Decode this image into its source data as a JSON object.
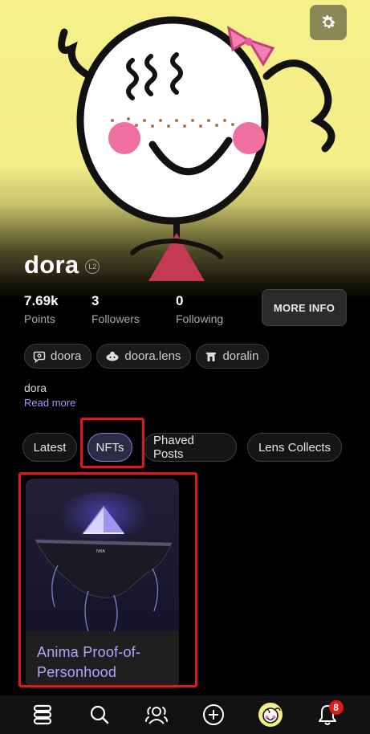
{
  "profile": {
    "name": "dora",
    "level_badge": "L2",
    "bio": "dora",
    "read_more_label": "Read more"
  },
  "stats": [
    {
      "value": "7.69k",
      "label": "Points"
    },
    {
      "value": "3",
      "label": "Followers"
    },
    {
      "value": "0",
      "label": "Following"
    }
  ],
  "more_info_label": "MORE INFO",
  "handles": [
    {
      "icon": "chat-bubble-icon",
      "label": "doora"
    },
    {
      "icon": "lens-leaf-icon",
      "label": "doora.lens"
    },
    {
      "icon": "gate-icon",
      "label": "doralin"
    }
  ],
  "tabs": [
    {
      "label": "Latest",
      "active": false
    },
    {
      "label": "NFTs",
      "active": true
    },
    {
      "label": "Phaved Posts",
      "active": false
    },
    {
      "label": "Lens Collects",
      "active": false
    }
  ],
  "nfts": [
    {
      "title": "Anima Proof-of-Personhood",
      "image": "floating-island-pyramid"
    }
  ],
  "bottom_nav": [
    {
      "icon": "feed-stack-icon"
    },
    {
      "icon": "search-icon"
    },
    {
      "icon": "people-icon"
    },
    {
      "icon": "plus-circle-icon"
    },
    {
      "icon": "profile-avatar-icon"
    },
    {
      "icon": "bell-icon",
      "badge": "8"
    }
  ],
  "colors": {
    "accent": "#a693ff",
    "highlight": "#e0171b",
    "cover_bg": "#f7f08a"
  }
}
